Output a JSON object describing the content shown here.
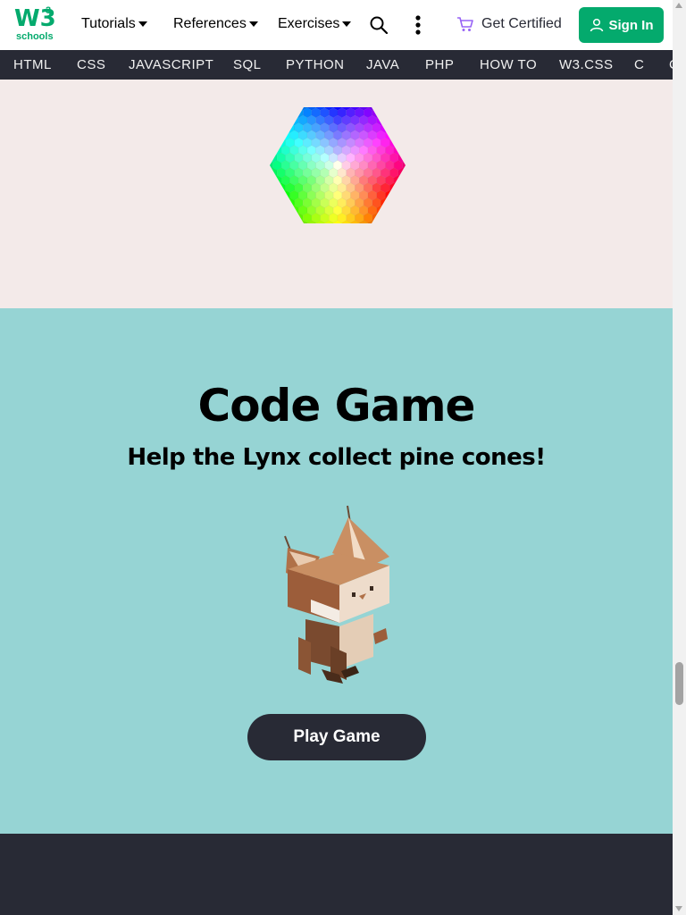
{
  "header": {
    "logo_text": "W3",
    "logo_sup": "3",
    "logo_sub": "schools",
    "menus": [
      "Tutorials",
      "References",
      "Exercises"
    ],
    "icons": {
      "search": "search-icon",
      "more": "more-vertical-icon",
      "cart": "cart-icon",
      "user": "user-icon"
    },
    "get_certified": "Get Certified",
    "sign_in": "Sign In",
    "accent_color": "#04AA6D"
  },
  "subjects": [
    "HTML",
    "CSS",
    "JAVASCRIPT",
    "SQL",
    "PYTHON",
    "JAVA",
    "PHP",
    "HOW TO",
    "W3.CSS",
    "C",
    "C"
  ],
  "game": {
    "title": "Code Game",
    "subtitle": "Help the Lynx collect pine cones!",
    "button": "Play Game",
    "background": "#96D4D4"
  },
  "colors": {
    "dark": "#282A35",
    "color_section_bg": "#F3EAE9"
  }
}
